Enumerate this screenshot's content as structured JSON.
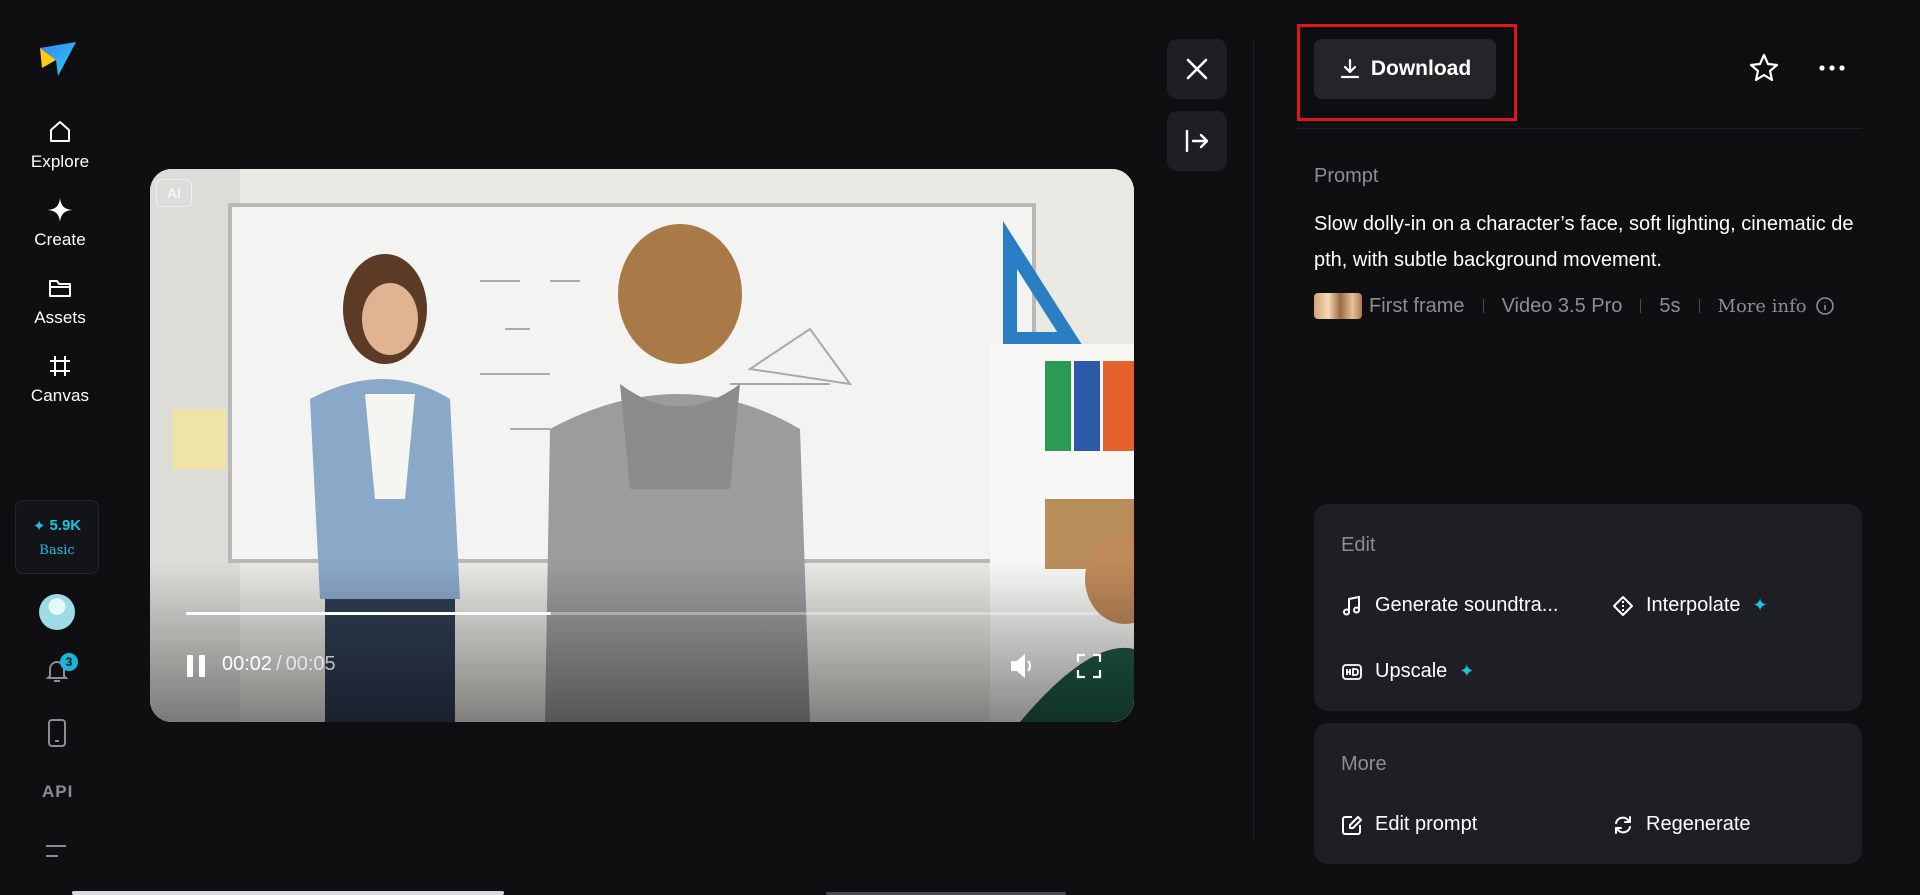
{
  "sidebar": {
    "items": [
      {
        "label": "Explore",
        "icon": "home-icon"
      },
      {
        "label": "Create",
        "icon": "sparkle-icon"
      },
      {
        "label": "Assets",
        "icon": "folder-icon"
      },
      {
        "label": "Canvas",
        "icon": "crop-icon"
      }
    ],
    "credits": {
      "amount": "5.9K",
      "plan": "Basic"
    },
    "notifications_count": "3",
    "api_label": "API"
  },
  "video": {
    "ai_tag": "AI",
    "current_time": "00:02",
    "separator": "/",
    "duration": "00:05",
    "progress": 0.4
  },
  "panel": {
    "download_label": "Download",
    "prompt_label": "Prompt",
    "prompt_text": "Slow dolly-in on a character’s face, soft lighting, cinematic depth, with subtle background movement.",
    "meta": {
      "first_frame": "First frame",
      "model": "Video 3.5 Pro",
      "duration": "5s",
      "more_info": "More info"
    },
    "edit": {
      "title": "Edit",
      "actions": [
        {
          "label": "Generate soundtra...",
          "icon": "music-note-icon",
          "premium": false
        },
        {
          "label": "Interpolate",
          "icon": "diamond-icon",
          "premium": true
        },
        {
          "label": "Upscale",
          "icon": "hd-icon",
          "premium": true
        }
      ]
    },
    "more": {
      "title": "More",
      "actions": [
        {
          "label": "Edit prompt",
          "icon": "edit-icon"
        },
        {
          "label": "Regenerate",
          "icon": "refresh-icon"
        }
      ]
    }
  },
  "colors": {
    "background": "#0f0f12",
    "card": "#1e1f24",
    "accent": "#19c3e6",
    "highlight": "#e0161c"
  }
}
